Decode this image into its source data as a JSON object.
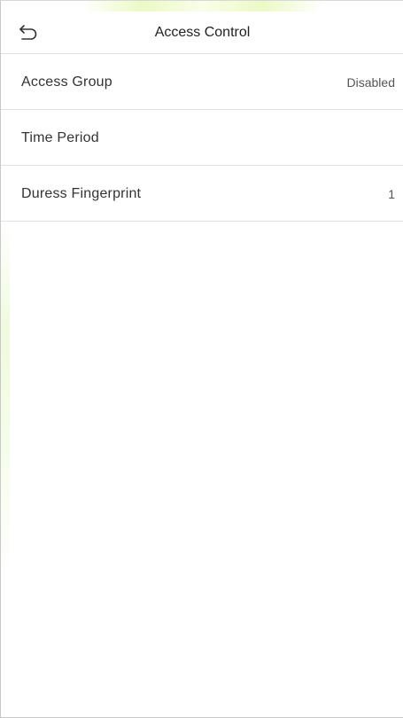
{
  "header": {
    "back_icon": "back-arrow-icon",
    "title": "Access Control"
  },
  "menu": {
    "items": [
      {
        "label": "Access Group",
        "value": "Disabled"
      },
      {
        "label": "Time Period",
        "value": ""
      },
      {
        "label": "Duress Fingerprint",
        "value": "1"
      }
    ]
  }
}
